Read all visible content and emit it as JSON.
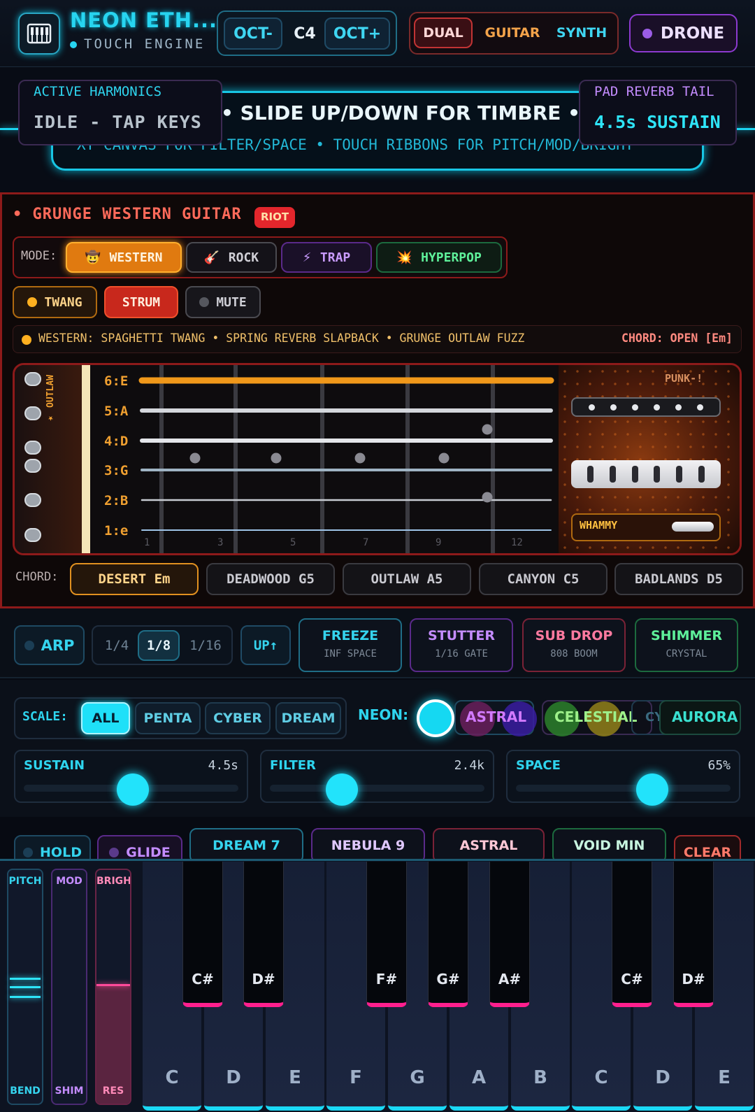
{
  "app": {
    "title": "NEON ETH...",
    "subtitle": "TOUCH ENGINE"
  },
  "octave": {
    "down": "OCT-",
    "current": "C4",
    "up": "OCT+"
  },
  "engine": {
    "dual": "DUAL",
    "guitar": "GUITAR",
    "synth": "SYNTH"
  },
  "drone": {
    "label": "DRONE"
  },
  "banner": {
    "marquee": "• SLIDE UP/DOWN FOR TIMBRE • FX",
    "hint": "XY CANVAS FOR FILTER/SPACE • TOUCH RIBBONS FOR PITCH/MOD/BRIGHT",
    "harmonics_label": "ACTIVE HARMONICS",
    "harmonics_value": "IDLE - TAP KEYS",
    "reverb_label": "PAD REVERB TAIL",
    "reverb_value": "4.5s SUSTAIN"
  },
  "guitar": {
    "title": "GRUNGE WESTERN GUITAR",
    "badge": "RIOT",
    "mode_label": "MODE:",
    "modes": [
      {
        "icon": "🤠",
        "label": "WESTERN"
      },
      {
        "icon": "🎸",
        "label": "ROCK"
      },
      {
        "icon": "⚡",
        "label": "TRAP"
      },
      {
        "icon": "💥",
        "label": "HYPERPOP"
      }
    ],
    "toggles": {
      "twang": "TWANG",
      "strum": "STRUM",
      "mute": "MUTE"
    },
    "status": "WESTERN: SPAGHETTI TWANG • SPRING REVERB SLAPBACK • GRUNGE OUTLAW FUZZ",
    "chord_status": "CHORD: OPEN [Em]",
    "headstock": "★ OUTLAW",
    "strings": [
      "6:E",
      "5:A",
      "4:D",
      "3:G",
      "2:B",
      "1:e"
    ],
    "frets": [
      "1",
      "3",
      "5",
      "7",
      "9",
      "12"
    ],
    "body_text": "PUNK-!",
    "whammy": "WHAMMY",
    "chord_label": "CHORD:",
    "chords": [
      "DESERT Em",
      "DEADWOOD G5",
      "OUTLAW A5",
      "CANYON C5",
      "BADLANDS D5"
    ]
  },
  "fx": {
    "arp": "ARP",
    "divisions": [
      "1/4",
      "1/8",
      "1/16"
    ],
    "direction": "UP↑",
    "buttons": [
      {
        "title": "FREEZE",
        "sub": "INF SPACE"
      },
      {
        "title": "STUTTER",
        "sub": "1/16 GATE"
      },
      {
        "title": "SUB DROP",
        "sub": "808 BOOM"
      },
      {
        "title": "SHIMMER",
        "sub": "CRYSTAL"
      }
    ]
  },
  "scale": {
    "label": "SCALE:",
    "options": [
      "ALL",
      "PENTA",
      "CYBER",
      "DREAM"
    ],
    "neon_label": "NEON:",
    "themes": [
      "ASTRAL",
      "CELESTIAL",
      "CYCAN",
      "AURORA"
    ]
  },
  "sliders": [
    {
      "label": "SUSTAIN",
      "value": "4.5s",
      "level": 0.5
    },
    {
      "label": "FILTER",
      "value": "2.4k",
      "level": 0.3
    },
    {
      "label": "SPACE",
      "value": "65%",
      "level": 0.65
    }
  ],
  "presets": {
    "hold": "HOLD",
    "glide": "GLIDE",
    "items": [
      "DREAM 7",
      "NEBULA 9",
      "ASTRAL",
      "VOID MIN"
    ],
    "clear": "CLEAR"
  },
  "ribbons": [
    {
      "top": "PITCH",
      "bottom": "BEND"
    },
    {
      "top": "MOD",
      "bottom": "SHIM"
    },
    {
      "top": "BRIGHT",
      "bottom": "RES"
    }
  ],
  "keys": {
    "white": [
      "C",
      "D",
      "E",
      "F",
      "G",
      "A",
      "B",
      "C",
      "D",
      "E"
    ],
    "black": [
      "C#",
      "D#",
      "F#",
      "G#",
      "A#",
      "C#",
      "D#"
    ]
  }
}
